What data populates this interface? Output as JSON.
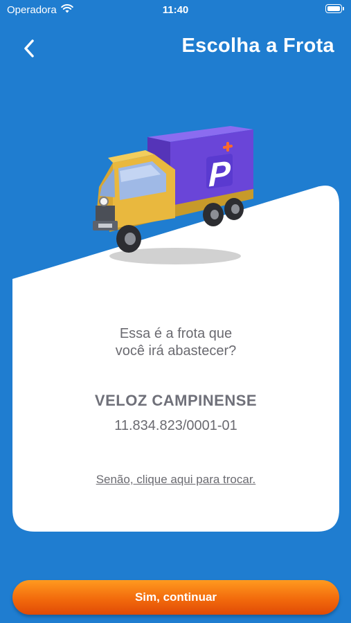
{
  "status_bar": {
    "carrier": "Operadora",
    "time": "11:40"
  },
  "header": {
    "title": "Escolha a Frota",
    "back_icon": "chevron-left-icon"
  },
  "illustration": {
    "name": "delivery-truck-illustration",
    "logo_letter": "P"
  },
  "card": {
    "question": "Essa é a frota que\nvocê irá abastecer?",
    "fleet_name": "VELOZ CAMPINENSE",
    "fleet_cnpj": "11.834.823/0001-01",
    "change_link": "Senão, clique aqui para trocar."
  },
  "actions": {
    "continue_label": "Sim, continuar"
  },
  "colors": {
    "background": "#1f7dd0",
    "card": "#ffffff",
    "button_top": "#ff9a1f",
    "button_bottom": "#e04a06",
    "truck_cab": "#e9b83e",
    "truck_box": "#6a45d8"
  }
}
